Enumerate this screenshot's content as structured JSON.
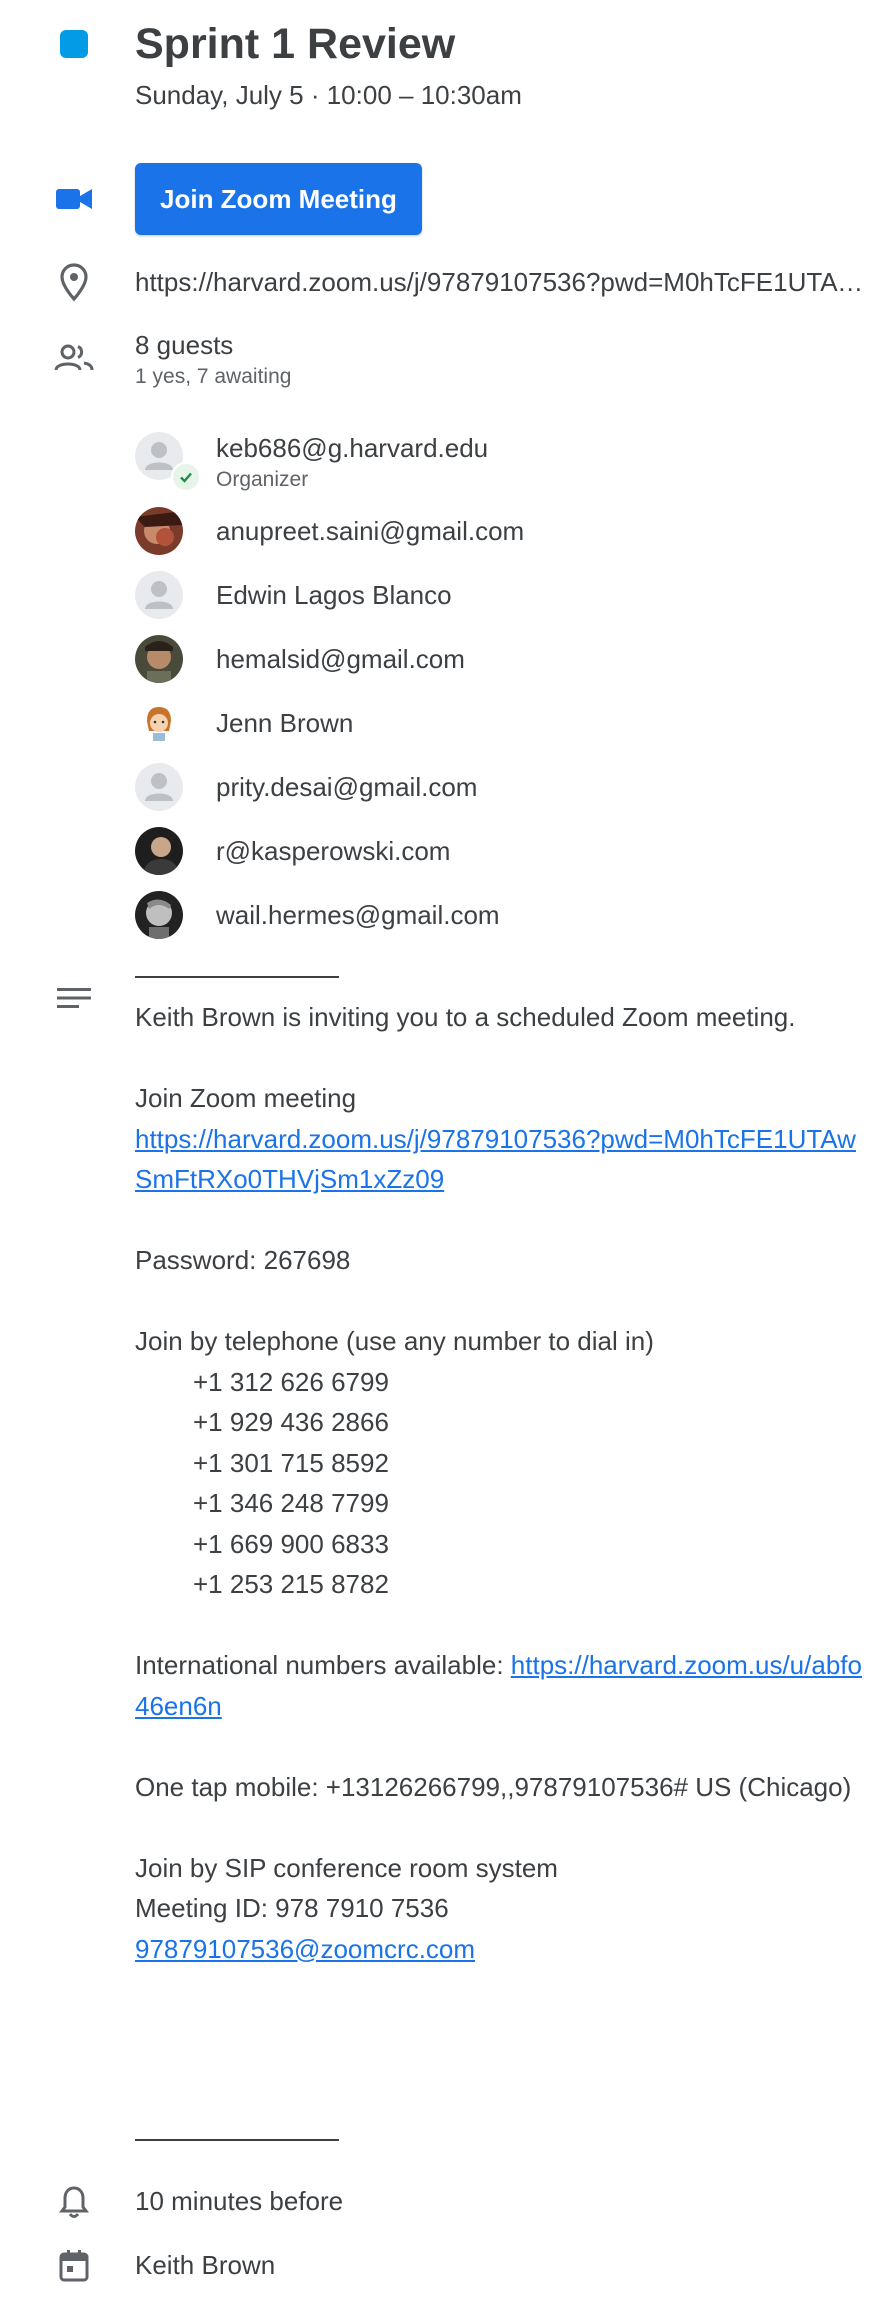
{
  "event": {
    "title": "Sprint 1 Review",
    "datetime": "Sunday, July 5  ·  10:00 – 10:30am",
    "color": "#039be5"
  },
  "conference": {
    "join_label": "Join Zoom Meeting",
    "accent": "#1a73e8"
  },
  "location": {
    "text": "https://harvard.zoom.us/j/97879107536?pwd=M0hTcFE1UTAwSmFtRXo0THVjSm1xZz09"
  },
  "guests": {
    "summary": "8 guests",
    "rsvp": "1 yes, 7 awaiting",
    "list": [
      {
        "name": "keb686@g.harvard.edu",
        "role": "Organizer",
        "avatar": "placeholder",
        "status": "yes"
      },
      {
        "name": "anupreet.saini@gmail.com",
        "avatar": "photo"
      },
      {
        "name": "Edwin Lagos Blanco",
        "avatar": "placeholder"
      },
      {
        "name": "hemalsid@gmail.com",
        "avatar": "photo"
      },
      {
        "name": "Jenn Brown",
        "avatar": "cartoon"
      },
      {
        "name": "prity.desai@gmail.com",
        "avatar": "placeholder"
      },
      {
        "name": "r@kasperowski.com",
        "avatar": "photo"
      },
      {
        "name": "wail.hermes@gmail.com",
        "avatar": "photo"
      }
    ]
  },
  "description": {
    "intro": "Keith Brown is inviting you to a scheduled Zoom meeting.",
    "join_heading": "Join Zoom meeting",
    "join_link": "https://harvard.zoom.us/j/97879107536?pwd=M0hTcFE1UTAwSmFtRXo0THVjSm1xZz09",
    "password": "Password: 267698",
    "phone_heading": "Join by telephone (use any number to dial in)",
    "phones": [
      "+1 312 626 6799",
      "+1 929 436 2866",
      "+1 301 715 8592",
      "+1 346 248 7799",
      "+1 669 900 6833",
      "+1 253 215 8782"
    ],
    "intl_label": "International numbers available: ",
    "intl_link": "https://harvard.zoom.us/u/abfo46en6n",
    "one_tap": "One tap mobile: +13126266799,,97879107536# US (Chicago)",
    "sip_heading": "Join by SIP conference room system",
    "meeting_id": "Meeting ID: 978 7910 7536",
    "sip_link": "97879107536@zoomcrc.com"
  },
  "reminder": {
    "text": "10 minutes before"
  },
  "calendar": {
    "owner": "Keith Brown"
  }
}
